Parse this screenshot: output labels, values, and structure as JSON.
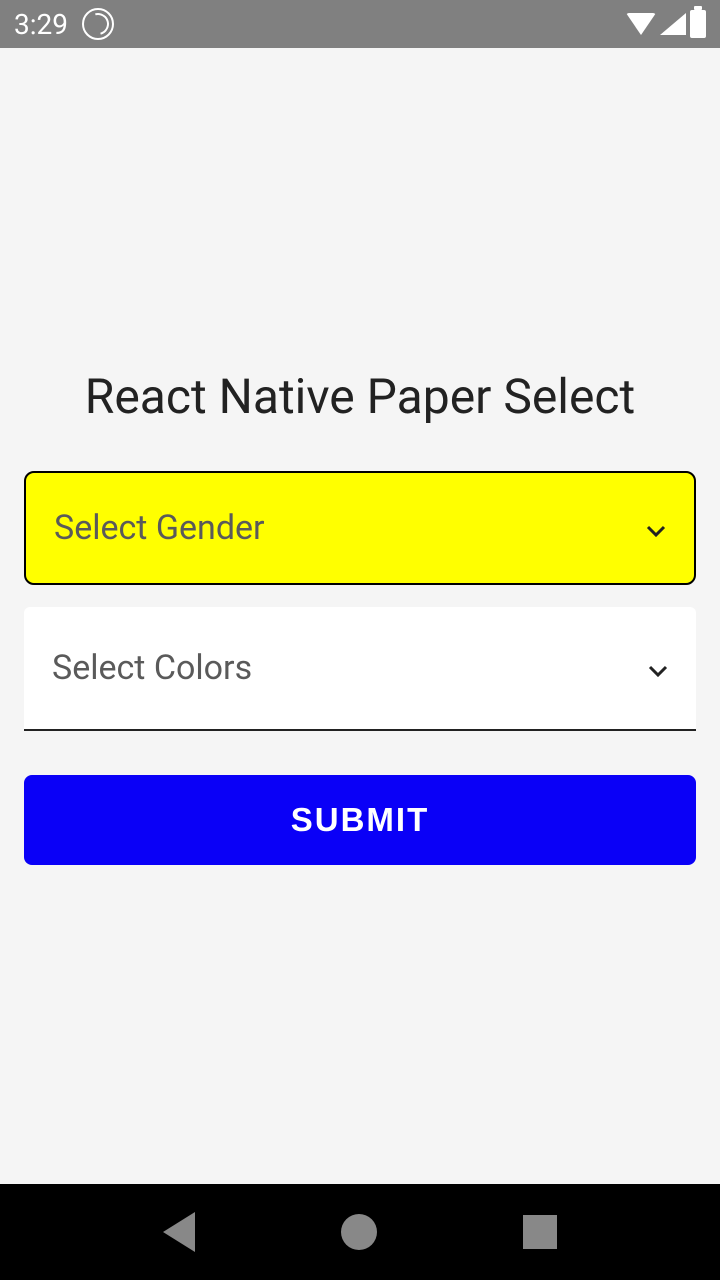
{
  "statusBar": {
    "time": "3:29"
  },
  "form": {
    "title": "React Native Paper Select",
    "genderSelect": {
      "placeholder": "Select Gender"
    },
    "colorsSelect": {
      "placeholder": "Select Colors"
    },
    "submitLabel": "SUBMIT"
  }
}
